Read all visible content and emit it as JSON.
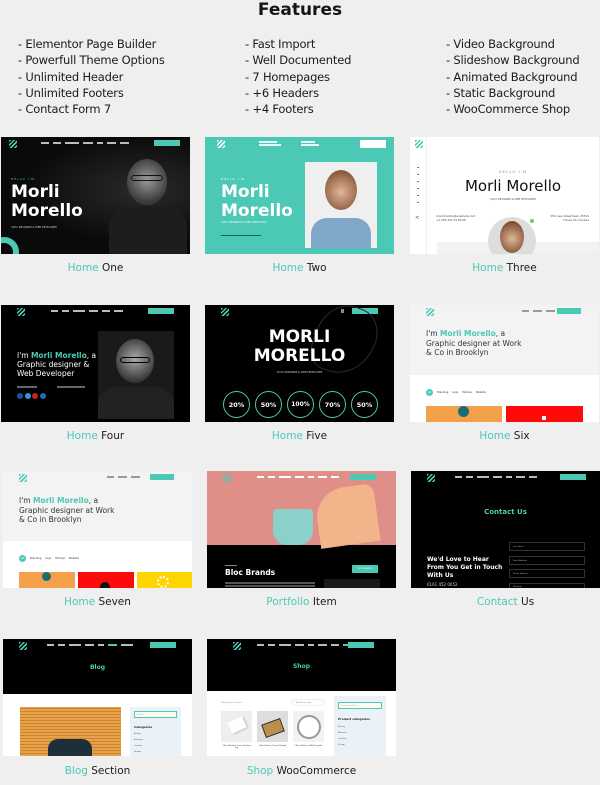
{
  "page": {
    "title": "Features"
  },
  "features": {
    "col1": [
      "- Elementor Page Builder",
      "- Powerfull Theme Options",
      "- Unlimited Header",
      "- Unlimited Footers",
      "- Contact Form 7"
    ],
    "col2": [
      "- Fast Import",
      "- Well Documented",
      "- 7 Homepages",
      "- +6 Headers",
      "- +4 Footers"
    ],
    "col3": [
      "- Video Background",
      "- Slideshow Background",
      "- Animated Background",
      "- Static Background",
      "- WooCommerce Shop"
    ]
  },
  "colors": {
    "accent": "#4cc9b4",
    "dark": "#0a0a0a",
    "background": "#efefef"
  },
  "demos": [
    {
      "accent": "Home",
      "rest": "One",
      "thumb": {
        "hello": "HELLO I'M",
        "name1": "Morli",
        "name2": "Morello",
        "sub": "UI/UX DESIGNER & WEB DEVELOPER"
      }
    },
    {
      "accent": "Home",
      "rest": "Two",
      "thumb": {
        "hello": "HELLO I'M",
        "name1": "Morli",
        "name2": "Morello",
        "sub": "UI/UX DESIGNER & WEB DEVELOPER"
      }
    },
    {
      "accent": "Home",
      "rest": "Three",
      "thumb": {
        "hello": "HELLO I'M",
        "name": "Morli Morello",
        "sub": "UI/UX DESIGNER & WEB DEVELOPER",
        "email": "morlimorello@example.com",
        "phone": "+1 256 321 54 84 56",
        "addr1": "550 new street town 25510",
        "addr2": "House 20, Canada"
      }
    },
    {
      "accent": "Home",
      "rest": "Four",
      "thumb": {
        "pre": "I'm ",
        "name": "Morli Morello",
        "post": ", a",
        "line2": "Graphic designer &",
        "line3": "Web Developer"
      }
    },
    {
      "accent": "Home",
      "rest": "Five",
      "thumb": {
        "line1": "MORLI",
        "line2": "MORELLO",
        "sub": "UI/UX DESIGNER & WEB DEVELOPER",
        "stats": [
          "20%",
          "50%",
          "100%",
          "70%",
          "50%"
        ]
      }
    },
    {
      "accent": "Home",
      "rest": "Six",
      "thumb": {
        "pre": "I'm ",
        "name": "Morli Morello",
        "post": ", a",
        "line2": "Graphic designer at Work",
        "line3": "& Co in Brooklyn",
        "filters": [
          "All",
          "Branding",
          "Logo",
          "Mockup",
          "Website"
        ]
      }
    },
    {
      "accent": "Home",
      "rest": "Seven",
      "thumb": {
        "pre": "I'm ",
        "name": "Morli Morello",
        "post": ", a",
        "line2": "Graphic designer at Work",
        "line3": "& Co in Brooklyn",
        "filters": [
          "All",
          "Branding",
          "Logo",
          "Mockup",
          "Website"
        ]
      }
    },
    {
      "accent": "Portfolio",
      "rest": "Item",
      "thumb": {
        "title": "Bloc Brands",
        "btn": "VISIT WEBSITE"
      }
    },
    {
      "accent": "Contact",
      "rest": "Us",
      "thumb": {
        "title": "Contact Us",
        "line1": "We'd Love to Hear",
        "line2": "From You Get in Touch",
        "line3": "With Us",
        "phone": "0161 452 0052",
        "fields": [
          "Your Name",
          "Email Address",
          "Phone Number",
          "Message"
        ]
      }
    },
    {
      "accent": "Blog",
      "rest": "Section",
      "thumb": {
        "title": "Blog",
        "search": "Search...",
        "cat_title": "Categories",
        "cats": [
          "Beauty",
          "Business",
          "Creative",
          "Design"
        ]
      }
    },
    {
      "accent": "Shop",
      "rest": "WooCommerce",
      "thumb": {
        "title": "Shop",
        "results": "Showing all 9 results",
        "sort": "Default sorting",
        "search": "Search Products...",
        "cat_title": "Product categories",
        "cats": [
          "Beauty",
          "Business",
          "Creative",
          "Design"
        ],
        "products": [
          "Office Branded Cursive Mockup Tag",
          "Office Product Cursive Mockup",
          "Office Product In Wall Template"
        ]
      }
    }
  ]
}
